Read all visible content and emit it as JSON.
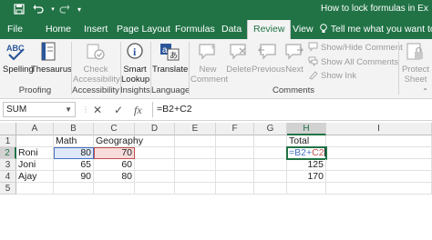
{
  "titlebar": {
    "title": "How to lock formulas in Ex",
    "save_icon": "save-icon",
    "undo_icon": "undo-icon",
    "redo_icon": "redo-icon"
  },
  "tabs": [
    {
      "label": "File"
    },
    {
      "label": "Home"
    },
    {
      "label": "Insert"
    },
    {
      "label": "Page Layout"
    },
    {
      "label": "Formulas"
    },
    {
      "label": "Data"
    },
    {
      "label": "Review",
      "active": true
    },
    {
      "label": "View"
    }
  ],
  "tell_me": "Tell me what you want to do",
  "ribbon": {
    "groups": {
      "proofing": "Proofing",
      "accessibility": "Accessibility",
      "insights": "Insights",
      "language": "Language",
      "comments": "Comments"
    },
    "buttons": {
      "spelling": "Spelling",
      "thesaurus": "Thesaurus",
      "check_accessibility_1": "Check",
      "check_accessibility_2": "Accessibility",
      "smart_lookup_1": "Smart",
      "smart_lookup_2": "Lookup",
      "translate": "Translate",
      "new_comment_1": "New",
      "new_comment_2": "Comment",
      "delete": "Delete",
      "previous": "Previous",
      "next": "Next",
      "show_hide_comment": "Show/Hide Comment",
      "show_all_comments": "Show All Comments",
      "show_ink": "Show Ink",
      "protect_sheet_1": "Protect",
      "protect_sheet_2": "Sheet"
    },
    "spelling_icon_text": "ABC"
  },
  "formula_bar": {
    "name_box": "SUM",
    "cancel_symbol": "✕",
    "enter_symbol": "✓",
    "fx_symbol": "fx",
    "formula": "=B2+C2"
  },
  "sheet": {
    "columns": [
      "A",
      "B",
      "C",
      "D",
      "E",
      "F",
      "G",
      "H",
      "I"
    ],
    "rows": [
      "1",
      "2",
      "3",
      "4",
      "5"
    ],
    "cells": {
      "B1": "Math",
      "C1": "Geography",
      "H1": "Total",
      "A2": "Roni",
      "B2": "80",
      "C2": "70",
      "H2_part1": "=B2+",
      "H2_part2": "C2",
      "A3": "Joni",
      "B3": "65",
      "C3": "60",
      "H3": "125",
      "A4": "Ajay",
      "B4": "90",
      "C4": "80",
      "H4": "170"
    }
  },
  "colors": {
    "excel_green": "#217346",
    "ref_blue": "#4472c4",
    "ref_red": "#c0504d"
  }
}
